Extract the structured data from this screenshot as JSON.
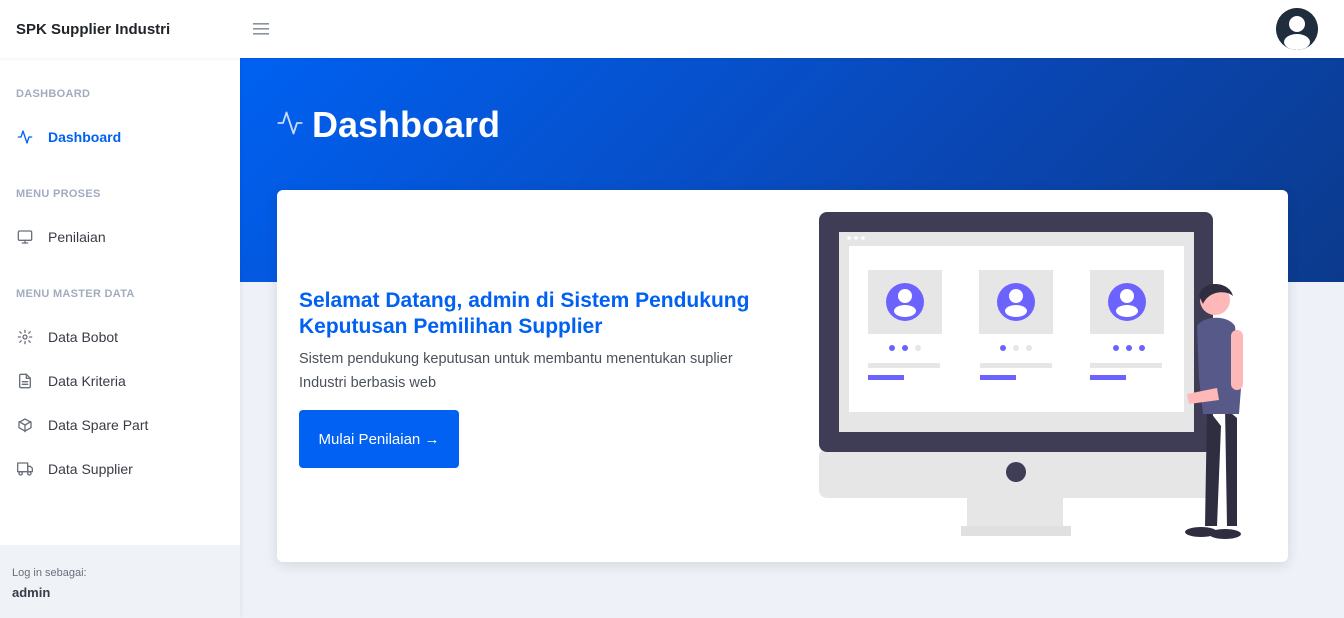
{
  "brand": "SPK Supplier Industri",
  "sidebar": {
    "sections": [
      {
        "heading": "DASHBOARD",
        "items": [
          {
            "label": "Dashboard",
            "icon": "activity-icon",
            "active": true
          }
        ]
      },
      {
        "heading": "MENU PROSES",
        "items": [
          {
            "label": "Penilaian",
            "icon": "monitor-icon"
          }
        ]
      },
      {
        "heading": "MENU MASTER DATA",
        "items": [
          {
            "label": "Data Bobot",
            "icon": "settings-icon"
          },
          {
            "label": "Data Kriteria",
            "icon": "file-text-icon"
          },
          {
            "label": "Data Spare Part",
            "icon": "box-icon"
          },
          {
            "label": "Data Supplier",
            "icon": "truck-icon"
          }
        ]
      }
    ],
    "footer": {
      "label": "Log in sebagai:",
      "user": "admin"
    }
  },
  "header": {
    "title": "Dashboard",
    "icon": "activity-icon"
  },
  "card": {
    "heading": "Selamat Datang, admin di Sistem Pendukung Keputusan Pemilihan Supplier",
    "text": "Sistem pendukung keputusan untuk membantu menentukan suplier Industri berbasis web",
    "button": "Mulai Penilaian →"
  },
  "colors": {
    "primary": "#0061f2",
    "accent_purple": "#6c63ff",
    "sidebar_heading": "#a2acbd"
  }
}
